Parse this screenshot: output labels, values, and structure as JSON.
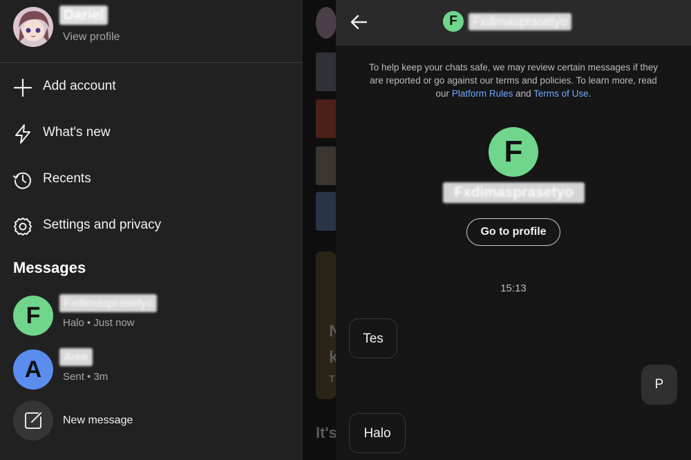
{
  "drawer": {
    "profile": {
      "name": "Dariel",
      "subtitle": "View profile"
    },
    "menu": [
      {
        "label": "Add account",
        "icon": "plus-icon"
      },
      {
        "label": "What's new",
        "icon": "lightning-icon"
      },
      {
        "label": "Recents",
        "icon": "clock-history-icon"
      },
      {
        "label": "Settings and privacy",
        "icon": "gear-icon"
      }
    ],
    "messages_title": "Messages",
    "conversations": [
      {
        "initial": "F",
        "name": "Fxdimasprasetyo",
        "status": "Halo • Just now",
        "color": "#6fd68b"
      },
      {
        "initial": "A",
        "name": "Aree",
        "status": "Sent • 3m",
        "color": "#5b8def"
      }
    ],
    "new_message": "New message"
  },
  "chat": {
    "header_initial": "F",
    "header_name": "Fxdimasprasetyo",
    "notice": {
      "text_before": "To help keep your chats safe, we may review certain messages if they are reported or go against our terms and policies. To learn more, read our",
      "link1": "Platform Rules",
      "and": "and",
      "link2": "Terms of Use",
      "end": "."
    },
    "profile_initial": "F",
    "profile_name": "Fxdimasprasetyo",
    "goto_profile": "Go to profile",
    "timestamp": "15:13",
    "messages": [
      {
        "text": "Tes",
        "direction": "incoming"
      },
      {
        "text": "P",
        "direction": "outgoing"
      },
      {
        "text": "Halo",
        "direction": "incoming"
      }
    ]
  },
  "background": {
    "partial_text_1": "N",
    "partial_text_2": "k",
    "partial_text_3": "T",
    "partial_heading": "It's"
  },
  "colors": {
    "accent_green": "#6fd68b",
    "accent_blue": "#5b8def",
    "link": "#6ea8ff"
  }
}
